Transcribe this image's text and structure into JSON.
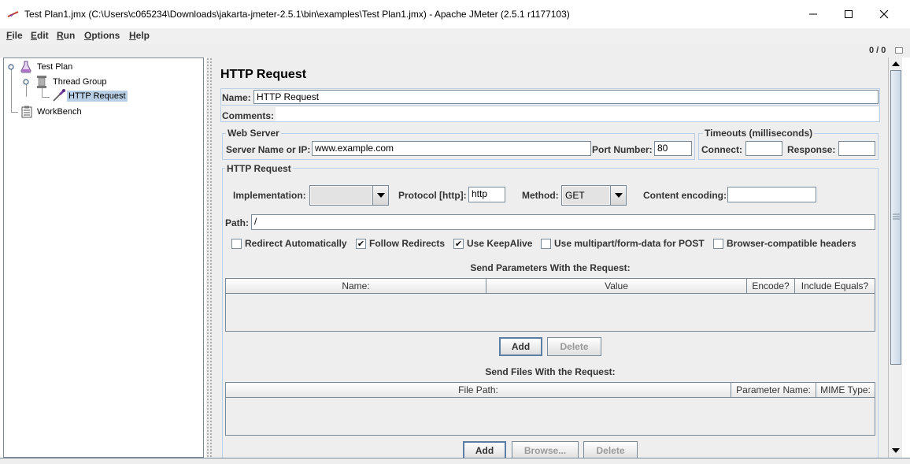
{
  "window": {
    "title": "Test Plan1.jmx (C:\\Users\\c065234\\Downloads\\jakarta-jmeter-2.5.1\\bin\\examples\\Test Plan1.jmx) - Apache JMeter (2.5.1 r1177103)",
    "controls": [
      "minimize-icon",
      "maximize-icon",
      "close-icon"
    ]
  },
  "menu": [
    {
      "key": "F",
      "rest": "ile"
    },
    {
      "key": "E",
      "rest": "dit"
    },
    {
      "key": "R",
      "rest": "un"
    },
    {
      "key": "O",
      "rest": "ptions"
    },
    {
      "key": "H",
      "rest": "elp"
    }
  ],
  "toolbar": {
    "counter": "0 / 0"
  },
  "tree": {
    "test_plan": "Test Plan",
    "thread_group": "Thread Group",
    "http_request": "HTTP Request",
    "workbench": "WorkBench"
  },
  "panel": {
    "title": "HTTP Request",
    "name_label": "Name:",
    "name_value": "HTTP Request",
    "comments_label": "Comments:",
    "comments_value": "",
    "web_server": {
      "title": "Web Server",
      "server_label": "Server Name or IP:",
      "server_value": "www.example.com",
      "port_label": "Port Number:",
      "port_value": "80"
    },
    "timeouts": {
      "title": "Timeouts (milliseconds)",
      "connect_label": "Connect:",
      "connect_value": "",
      "response_label": "Response:",
      "response_value": ""
    },
    "http_request_group": {
      "title": "HTTP Request",
      "implementation_label": "Implementation:",
      "implementation_value": "",
      "protocol_label": "Protocol [http]:",
      "protocol_value": "http",
      "method_label": "Method:",
      "method_value": "GET",
      "encoding_label": "Content encoding:",
      "encoding_value": "",
      "path_label": "Path:",
      "path_value": "/"
    },
    "checkboxes": [
      {
        "label": "Redirect Automatically",
        "checked": false
      },
      {
        "label": "Follow Redirects",
        "checked": true
      },
      {
        "label": "Use KeepAlive",
        "checked": true
      },
      {
        "label": "Use multipart/form-data for POST",
        "checked": false
      },
      {
        "label": "Browser-compatible headers",
        "checked": false
      }
    ],
    "params": {
      "title": "Send Parameters With the Request:",
      "columns": [
        "Name:",
        "Value",
        "Encode?",
        "Include Equals?"
      ],
      "add": "Add",
      "delete": "Delete"
    },
    "files": {
      "title": "Send Files With the Request:",
      "columns": [
        "File Path:",
        "Parameter Name:",
        "MIME Type:"
      ],
      "add": "Add",
      "browse": "Browse...",
      "delete": "Delete"
    }
  }
}
